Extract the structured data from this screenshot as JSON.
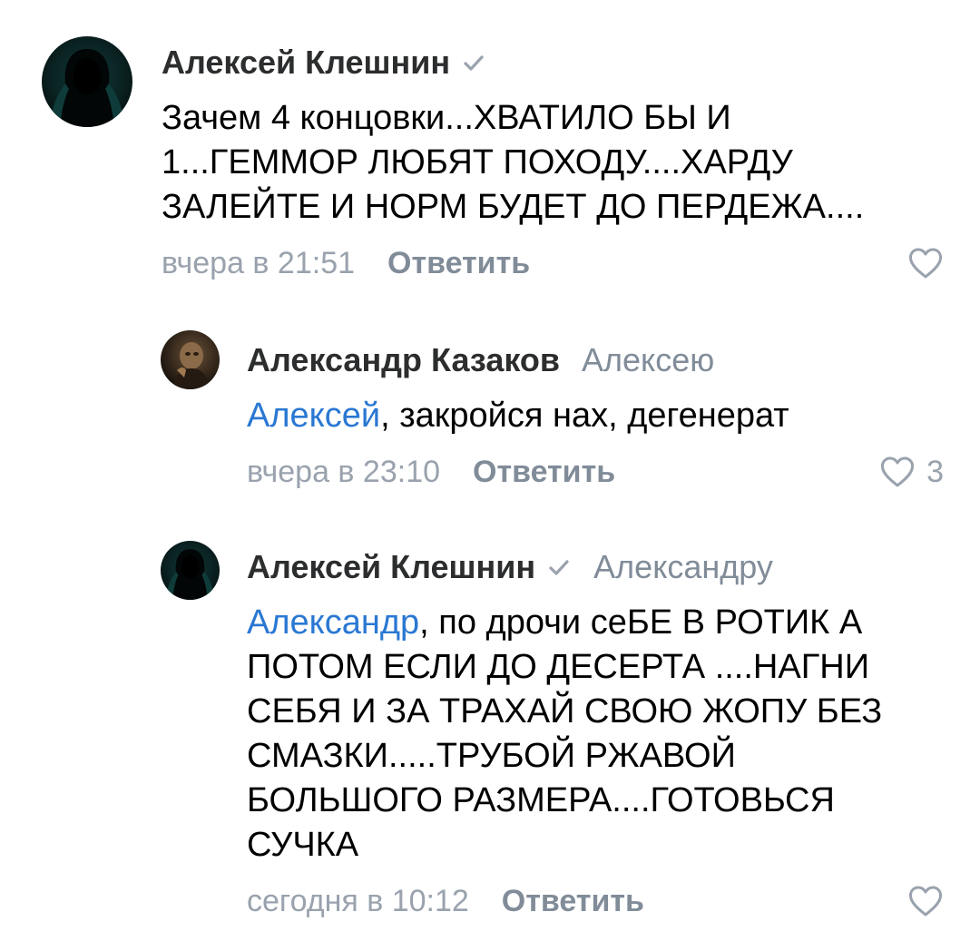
{
  "colors": {
    "author": "#2c2d2e",
    "secondary": "#99a2ad",
    "action": "#818c99",
    "link": "#2a78d3"
  },
  "comments": [
    {
      "author": "Алексей Клешнин",
      "verified": true,
      "reply_to": "",
      "mention": "",
      "text": "Зачем 4 концовки...ХВАТИЛО БЫ И 1...ГЕММОР ЛЮБЯТ ПОХОДУ....ХАРДУ ЗАЛЕЙТЕ И НОРМ БУДЕТ ДО ПЕРДЕЖА....",
      "time": "вчера в 21:51",
      "reply_label": "Ответить",
      "like_icon": "heart-icon",
      "likes": ""
    },
    {
      "author": "Александр Казаков",
      "verified": false,
      "reply_to": "Алексею",
      "mention": "Алексей",
      "text": ", закройся нах, дегенерат",
      "time": "вчера в 23:10",
      "reply_label": "Ответить",
      "like_icon": "heart-icon",
      "likes": "3"
    },
    {
      "author": "Алексей Клешнин",
      "verified": true,
      "reply_to": "Александру",
      "mention": "Александр",
      "text": ", по дрочи сеБЕ В РОТИК А ПОТОМ ЕСЛИ ДО ДЕСЕРТА ....НАГНИ СЕБЯ И ЗА ТРАХАЙ СВОЮ ЖОПУ БЕЗ СМАЗКИ.....ТРУБОЙ РЖАВОЙ БОЛЬШОГО РАЗМЕРА....ГОТОВЬСЯ СУЧКА",
      "time": "сегодня в 10:12",
      "reply_label": "Ответить",
      "like_icon": "heart-icon",
      "likes": ""
    }
  ]
}
